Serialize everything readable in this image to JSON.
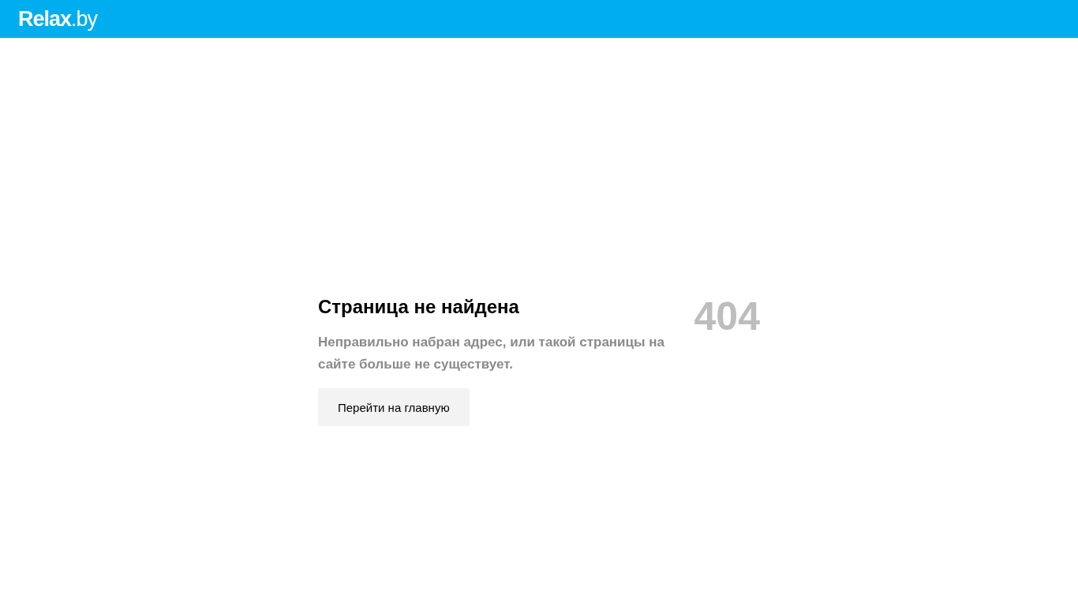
{
  "header": {
    "logo": "**Relax**.by"
  },
  "error": {
    "title": "Страница не найдена",
    "message": "Неправильно набран адрес, или такой страницы на сайте больше не существует.",
    "code": "404",
    "button": "Перейти на главную"
  }
}
